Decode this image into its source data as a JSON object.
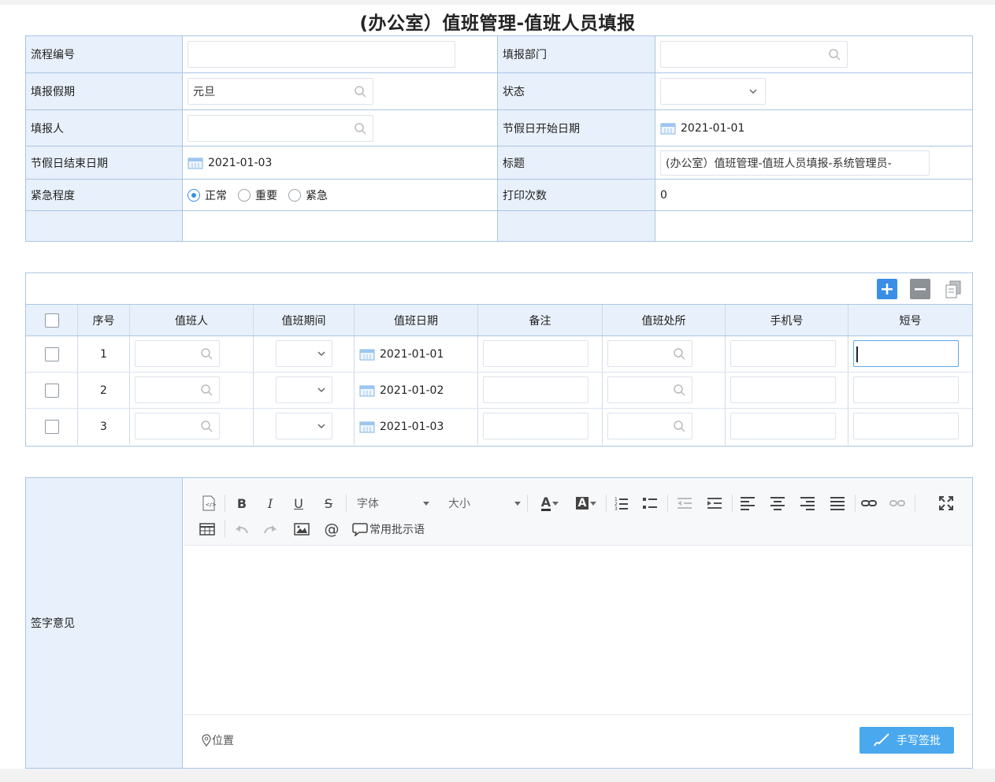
{
  "title": "(办公室）值班管理-值班人员填报",
  "form": {
    "flow_no_label": "流程编号",
    "flow_no_value": "",
    "dept_label": "填报部门",
    "dept_value": "",
    "holiday_label": "填报假期",
    "holiday_value": "元旦",
    "status_label": "状态",
    "status_value": "",
    "reporter_label": "填报人",
    "reporter_value": "",
    "start_label": "节假日开始日期",
    "start_value": "2021-01-01",
    "end_label": "节假日结束日期",
    "end_value": "2021-01-03",
    "subject_label": "标题",
    "subject_value": "(办公室）值班管理-值班人员填报-系统管理员-",
    "urgency_label": "紧急程度",
    "urgency_options": [
      "正常",
      "重要",
      "紧急"
    ],
    "urgency_selected": "正常",
    "print_label": "打印次数",
    "print_value": "0"
  },
  "grid": {
    "toolbar": {
      "add": "add-row",
      "remove": "remove-row",
      "copy": "copy-row"
    },
    "headers": [
      "序号",
      "值班人",
      "值班期间",
      "值班日期",
      "备注",
      "值班处所",
      "手机号",
      "短号"
    ],
    "rows": [
      {
        "no": "1",
        "date": "2021-01-01"
      },
      {
        "no": "2",
        "date": "2021-01-02"
      },
      {
        "no": "3",
        "date": "2021-01-03"
      }
    ]
  },
  "opinion": {
    "label": "签字意见",
    "font_label": "字体",
    "size_label": "大小",
    "phrases_label": "常用批示语",
    "location_label": "位置",
    "sign_button": "手写签批"
  },
  "colors": {
    "accent": "#3a8ee6",
    "label_bg": "#e8f0fb",
    "border": "#a9c6e4",
    "sign_button": "#4aa8ef"
  }
}
